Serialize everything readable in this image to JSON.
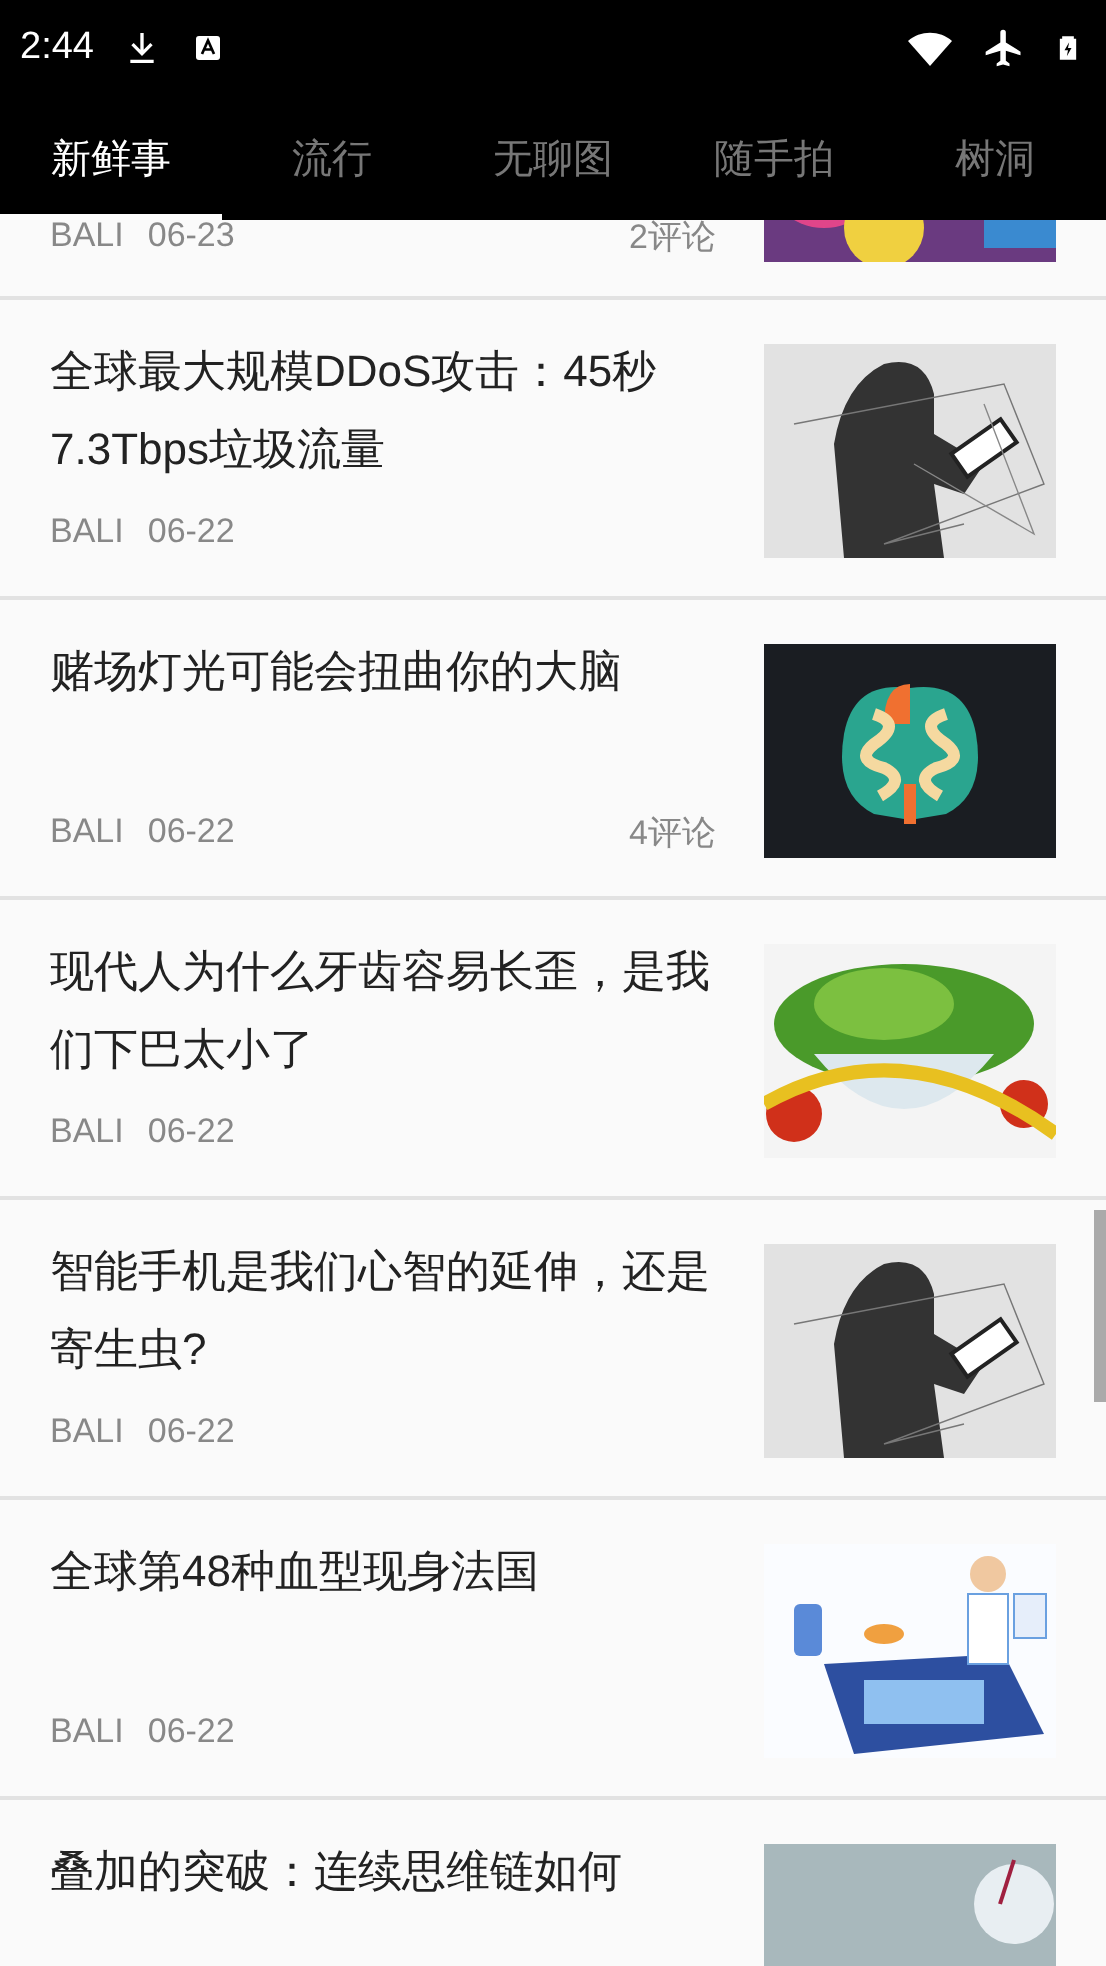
{
  "status_bar": {
    "time": "2:44"
  },
  "tabs": [
    {
      "label": "新鲜事",
      "selected": true
    },
    {
      "label": "流行",
      "selected": false
    },
    {
      "label": "无聊图",
      "selected": false
    },
    {
      "label": "随手拍",
      "selected": false
    },
    {
      "label": "树洞",
      "selected": false
    }
  ],
  "articles": [
    {
      "author": "BALI",
      "date": "06-23",
      "comments": "2评论"
    },
    {
      "title": "全球最大规模DDoS攻击：45秒7.3Tbps垃圾流量",
      "author": "BALI",
      "date": "06-22"
    },
    {
      "title": "赌场灯光可能会扭曲你的大脑",
      "author": "BALI",
      "date": "06-22",
      "comments": "4评论"
    },
    {
      "title": "现代人为什么牙齿容易长歪，是我们下巴太小了",
      "author": "BALI",
      "date": "06-22"
    },
    {
      "title": "智能手机是我们心智的延伸，还是寄生虫?",
      "author": "BALI",
      "date": "06-22"
    },
    {
      "title": "全球第48种血型现身法国",
      "author": "BALI",
      "date": "06-22"
    },
    {
      "title": "叠加的突破：连续思维链如何"
    }
  ]
}
